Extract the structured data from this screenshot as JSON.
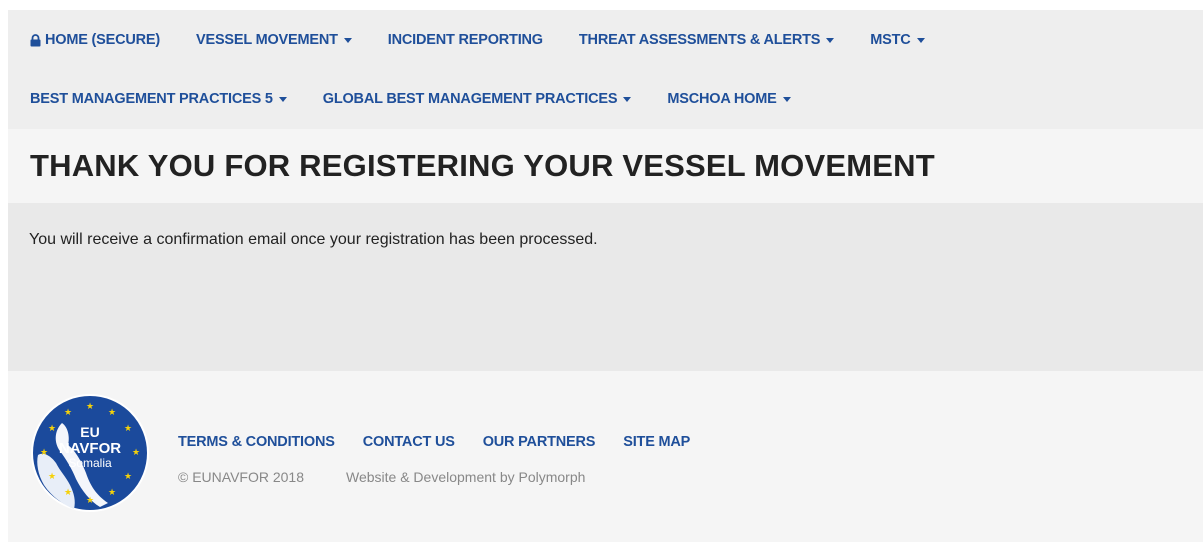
{
  "nav": {
    "row1": [
      {
        "label": "HOME (SECURE)",
        "icon": "lock-icon",
        "dropdown": false
      },
      {
        "label": "VESSEL MOVEMENT",
        "dropdown": true
      },
      {
        "label": "INCIDENT REPORTING",
        "dropdown": false
      },
      {
        "label": "THREAT ASSESSMENTS & ALERTS",
        "dropdown": true
      },
      {
        "label": "MSTC",
        "dropdown": true
      }
    ],
    "row2": [
      {
        "label": "BEST MANAGEMENT PRACTICES 5",
        "dropdown": true
      },
      {
        "label": "GLOBAL BEST MANAGEMENT PRACTICES",
        "dropdown": true
      },
      {
        "label": "MSCHOA HOME",
        "dropdown": true
      }
    ]
  },
  "page": {
    "title": "THANK YOU FOR REGISTERING YOUR VESSEL MOVEMENT",
    "message": "You will receive a confirmation email once your registration has been processed."
  },
  "footer": {
    "logo": {
      "line1": "EU",
      "line2": "NAVFOR",
      "line3": "Somalia"
    },
    "links": [
      "TERMS & CONDITIONS",
      "CONTACT US",
      "OUR PARTNERS",
      "SITE MAP"
    ],
    "copyright": "© EUNAVFOR 2018",
    "credit": "Website & Development by Polymorph"
  },
  "colors": {
    "link": "#1f4f9a",
    "nav_bg": "#eeeeee",
    "content_bg": "#e9e9e9",
    "logo_blue": "#1b4a9c",
    "star_yellow": "#f5d10a"
  }
}
